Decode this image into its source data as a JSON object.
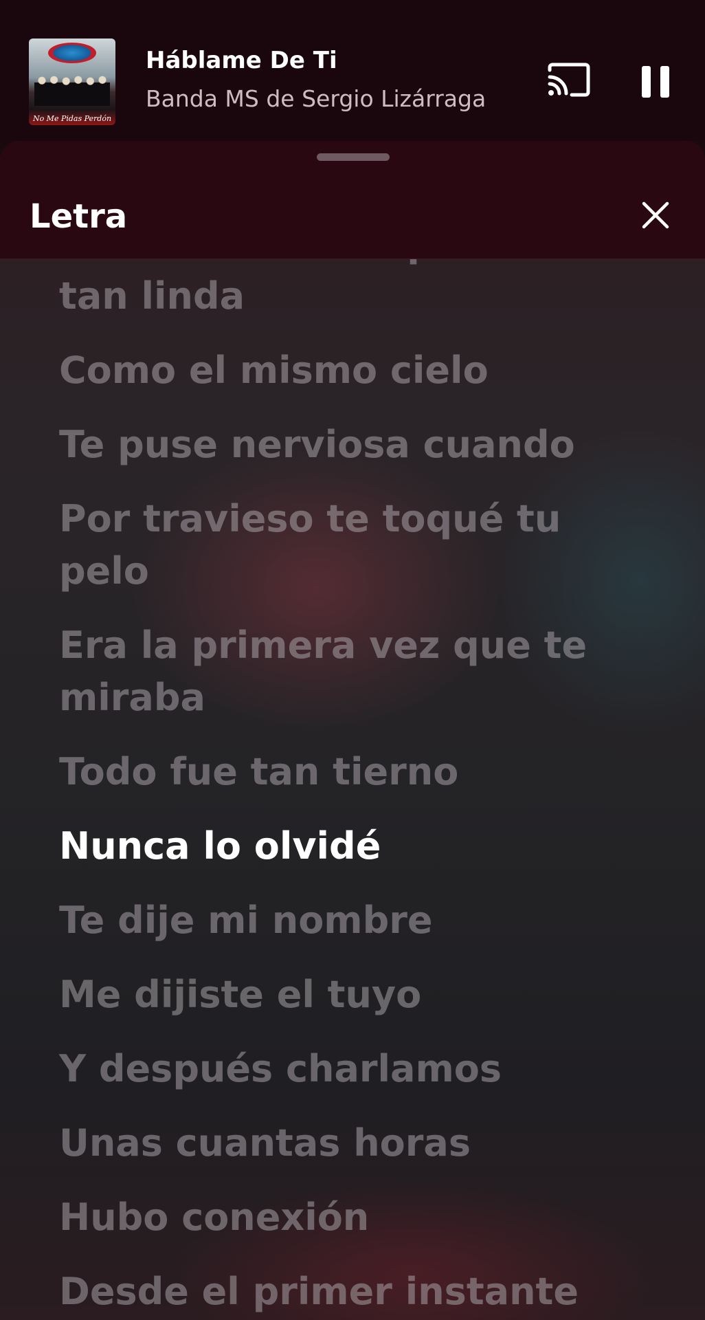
{
  "now_playing": {
    "title": "Háblame De Ti",
    "artist": "Banda MS de Sergio Lizárraga",
    "album_caption": "No Me Pidas Perdón"
  },
  "sheet": {
    "title": "Letra"
  },
  "lyrics": [
    {
      "text": "Con una sonrisa por cierto tan linda",
      "active": false
    },
    {
      "text": "Como el mismo cielo",
      "active": false
    },
    {
      "text": "Te puse nerviosa cuando",
      "active": false
    },
    {
      "text": "Por travieso te toqué tu pelo",
      "active": false
    },
    {
      "text": "Era la primera vez que te miraba",
      "active": false
    },
    {
      "text": "Todo fue tan tierno",
      "active": false
    },
    {
      "text": "Nunca lo olvidé",
      "active": true
    },
    {
      "text": "Te dije mi nombre",
      "active": false
    },
    {
      "text": "Me dijiste el tuyo",
      "active": false
    },
    {
      "text": "Y después charlamos",
      "active": false
    },
    {
      "text": "Unas cuantas horas",
      "active": false
    },
    {
      "text": "Hubo conexión",
      "active": false
    },
    {
      "text": "Desde el primer instante",
      "active": false
    }
  ],
  "icons": {
    "cast": "cast-icon",
    "pause": "pause-icon",
    "close": "close-icon"
  },
  "colors": {
    "header_bg": "#1a070e",
    "sheet_header_bg": "#2a0811",
    "active_lyric": "#ffffff",
    "inactive_lyric": "#8a8589"
  }
}
